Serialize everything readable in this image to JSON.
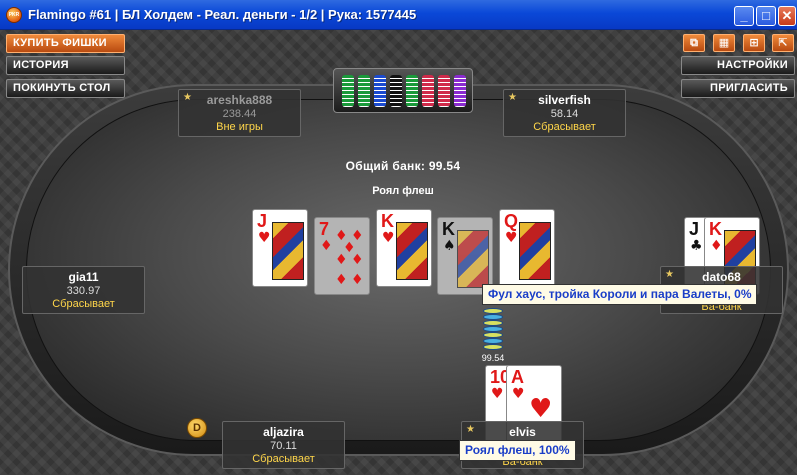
{
  "window": {
    "title": "Flamingo #61 | БЛ Холдем - Реал. деньги - 1/2 | Рука: 1577445",
    "app_icon": "PKR"
  },
  "left_buttons": {
    "buy_chips": "КУПИТЬ ФИШКИ",
    "history": "ИСТОРИЯ",
    "leave_table": "ПОКИНУТЬ СТОЛ"
  },
  "right_buttons": {
    "settings": "НАСТРОЙКИ",
    "invite": "ПРИГЛАСИТЬ"
  },
  "table": {
    "pot_label": "Общий банк: 99.54",
    "winning_hand": "Роял флеш",
    "pot_chips_amount": "99.54",
    "dealer_button": "D"
  },
  "board_cards": [
    {
      "rank": "J",
      "suit": "♥",
      "color": "red"
    },
    {
      "rank": "7",
      "suit": "♦",
      "color": "red"
    },
    {
      "rank": "K",
      "suit": "♥",
      "color": "red"
    },
    {
      "rank": "K",
      "suit": "♠",
      "color": "black"
    },
    {
      "rank": "Q",
      "suit": "♥",
      "color": "red"
    }
  ],
  "seats": {
    "areshka": {
      "name": "areshka888",
      "stack": "238.44",
      "status": "Вне игры"
    },
    "silverfish": {
      "name": "silverfish",
      "stack": "58.14",
      "status": "Сбрасывает"
    },
    "gia11": {
      "name": "gia11",
      "stack": "330.97",
      "status": "Сбрасывает"
    },
    "dato68": {
      "name": "dato68",
      "status": "Ва-банк"
    },
    "aljazira": {
      "name": "aljazira",
      "stack": "70.11",
      "status": "Сбрасывает"
    },
    "elvis": {
      "name": "elvis",
      "status": "Ва-банк"
    }
  },
  "hole_cards": {
    "dato68": [
      {
        "rank": "J",
        "suit": "♣",
        "color": "black"
      },
      {
        "rank": "K",
        "suit": "♦",
        "color": "red"
      }
    ],
    "elvis": [
      {
        "rank": "10",
        "suit": "♥",
        "color": "red"
      },
      {
        "rank": "A",
        "suit": "♥",
        "color": "red"
      }
    ]
  },
  "tooltips": {
    "dato68": "Фул хаус, тройка Короли и пара Валеты, 0%",
    "elvis": "Роял флеш, 100%"
  },
  "colors": {
    "accent_orange": "#f07a2a",
    "status_yellow": "#ffd64a",
    "tooltip_text": "#1a3ec8",
    "titlebar_blue": "#0a48d8"
  }
}
